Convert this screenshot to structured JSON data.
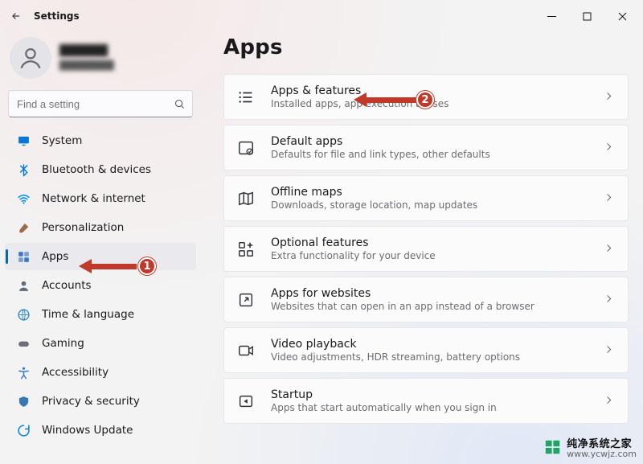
{
  "window": {
    "title": "Settings"
  },
  "profile": {
    "name": "██████",
    "email": "████████"
  },
  "search": {
    "placeholder": "Find a setting"
  },
  "sidebar": {
    "items": [
      {
        "label": "System",
        "icon": "system"
      },
      {
        "label": "Bluetooth & devices",
        "icon": "bluetooth"
      },
      {
        "label": "Network & internet",
        "icon": "wifi"
      },
      {
        "label": "Personalization",
        "icon": "brush"
      },
      {
        "label": "Apps",
        "icon": "apps",
        "active": true
      },
      {
        "label": "Accounts",
        "icon": "person"
      },
      {
        "label": "Time & language",
        "icon": "globe-clock"
      },
      {
        "label": "Gaming",
        "icon": "gamepad"
      },
      {
        "label": "Accessibility",
        "icon": "accessibility"
      },
      {
        "label": "Privacy & security",
        "icon": "shield"
      },
      {
        "label": "Windows Update",
        "icon": "update"
      }
    ]
  },
  "page": {
    "title": "Apps"
  },
  "cards": [
    {
      "title": "Apps & features",
      "sub": "Installed apps, app execution aliases",
      "icon": "list"
    },
    {
      "title": "Default apps",
      "sub": "Defaults for file and link types, other defaults",
      "icon": "default-apps"
    },
    {
      "title": "Offline maps",
      "sub": "Downloads, storage location, map updates",
      "icon": "map"
    },
    {
      "title": "Optional features",
      "sub": "Extra functionality for your device",
      "icon": "grid-plus"
    },
    {
      "title": "Apps for websites",
      "sub": "Websites that can open in an app instead of a browser",
      "icon": "open-in-app"
    },
    {
      "title": "Video playback",
      "sub": "Video adjustments, HDR streaming, battery options",
      "icon": "video"
    },
    {
      "title": "Startup",
      "sub": "Apps that start automatically when you sign in",
      "icon": "startup"
    }
  ],
  "annotations": {
    "b1": "1",
    "b2": "2"
  },
  "watermark": {
    "cn": "纯净系统之家",
    "url": "www.ycwjz.com"
  },
  "iconColors": {
    "system": "#0078d4",
    "bluetooth": "#0078d4",
    "wifi": "#0091ea",
    "brush": "#9a6b46",
    "apps": "#2a6cb0",
    "person": "#5f6a7a",
    "globe-clock": "#3a8dc0",
    "gamepad": "#6a6f7a",
    "accessibility": "#2a7acc",
    "shield": "#3a77b0",
    "update": "#0a84d8"
  }
}
